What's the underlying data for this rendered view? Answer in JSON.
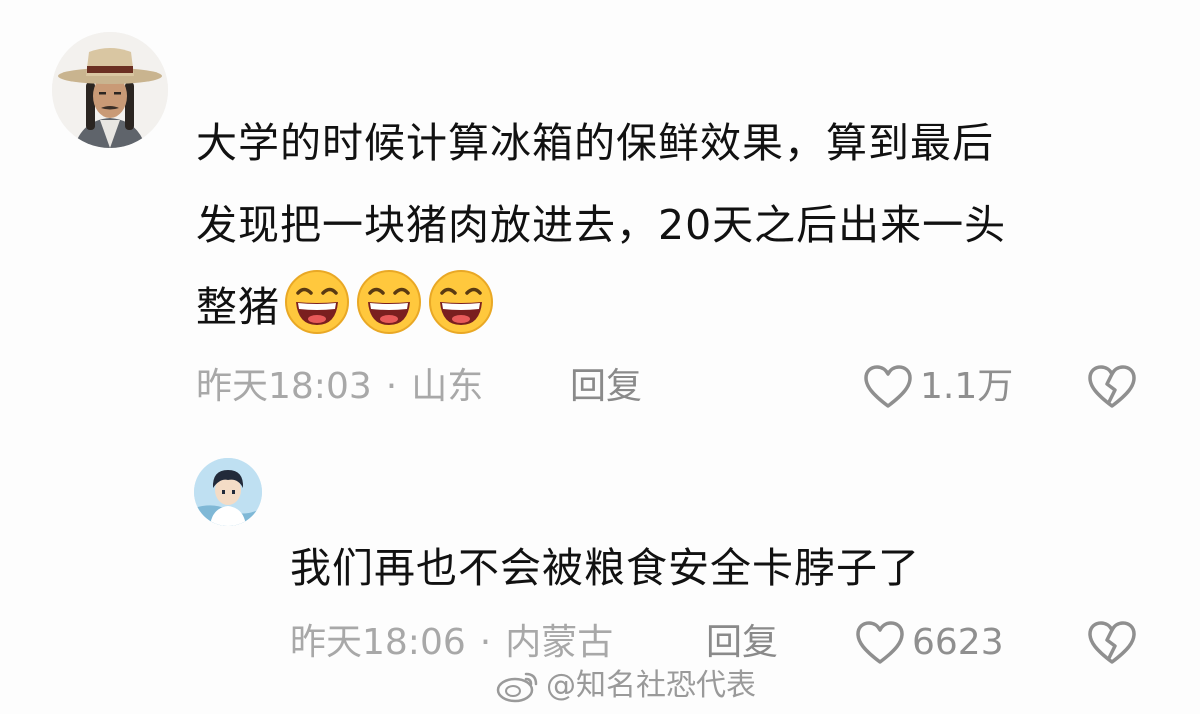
{
  "comment": {
    "avatar_icon": "user-avatar-hat-icon",
    "text_line1": "大学的时候计算冰箱的保鲜效果，算到最后",
    "text_line2": "发现把一块猪肉放进去，20天之后出来一头",
    "text_line3": "整猪",
    "emoji_icon": "grinning-face-emoji-icon",
    "emoji_count": 3,
    "time": "昨天18:03",
    "separator": "·",
    "location": "山东",
    "reply_label": "回复",
    "like_count": "1.1万"
  },
  "reply": {
    "avatar_icon": "anime-avatar-icon",
    "text": "我们再也不会被粮食安全卡脖子了",
    "time": "昨天18:06",
    "separator": "·",
    "location": "内蒙古",
    "reply_label": "回复",
    "like_count": "6623"
  },
  "watermark": {
    "icon": "weibo-logo-icon",
    "text": "@知名社恐代表"
  },
  "colors": {
    "text": "#111111",
    "meta": "#a8a8a8",
    "icon_gray": "#8f8f8f",
    "emoji_yellow": "#ffc83d"
  }
}
